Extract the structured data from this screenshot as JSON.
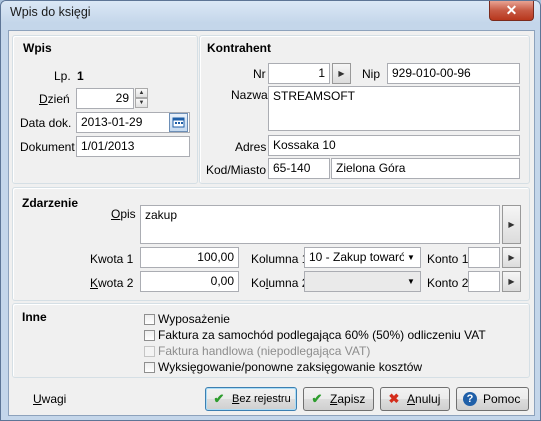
{
  "window": {
    "title": "Wpis do księgi",
    "close_glyph": "✕"
  },
  "wpis": {
    "title": "Wpis",
    "lp_label": "Lp.",
    "lp_value": "1",
    "dzien_label": "Dzień",
    "dzien_value": "29",
    "data_label": "Data dok.",
    "data_value": "2013-01-29",
    "dokument_label": "Dokument",
    "dokument_value": "1/01/2013"
  },
  "kontrahent": {
    "title": "Kontrahent",
    "nr_label": "Nr",
    "nr_value": "1",
    "nip_label": "Nip",
    "nip_value": "929-010-00-96",
    "nazwa_label": "Nazwa",
    "nazwa_value": "STREAMSOFT",
    "adres_label": "Adres",
    "adres_value": "Kossaka 10",
    "kod_label": "Kod/Miasto",
    "kod_value": "65-140",
    "miasto_value": "Zielona Góra"
  },
  "zdarzenie": {
    "title": "Zdarzenie",
    "opis_label": "Opis",
    "opis_value": "zakup",
    "kwota1_label": "Kwota 1",
    "kwota1_value": "100,00",
    "kwota2_label": "Kwota 2",
    "kwota2_value": "0,00",
    "kolumna1_label": "Kolumna 1",
    "kolumna1_value": "10 - Zakup towaró",
    "kolumna2_label": "Kolumna 2",
    "kolumna2_value": "",
    "konto1_label": "Konto 1",
    "konto1_value": "",
    "konto2_label": "Konto 2",
    "konto2_value": ""
  },
  "inne": {
    "title": "Inne",
    "options": [
      {
        "label": "Wyposażenie",
        "checked": false,
        "enabled": true
      },
      {
        "label": "Faktura za samochód podlegająca 60% (50%) odliczeniu VAT",
        "checked": false,
        "enabled": true
      },
      {
        "label": "Faktura handlowa (niepodlegająca VAT)",
        "checked": false,
        "enabled": false
      },
      {
        "label": "Wyksięgowanie/ponowne zaksięgowanie kosztów",
        "checked": false,
        "enabled": true
      }
    ]
  },
  "footer": {
    "uwagi_label": "Uwagi",
    "bez_rejestru_label": "Bez rejestru",
    "zapisz_label": "Zapisz",
    "anuluj_label": "Anuluj",
    "pomoc_label": "Pomoc"
  },
  "icons": {
    "arrow_right": "▶",
    "arrow_down": "▼",
    "spin_up": "▲",
    "spin_down": "▼",
    "check": "✔",
    "cross": "✖",
    "help": "?"
  },
  "colors": {
    "accent_green": "#2e9d2e",
    "accent_red": "#d42c1a",
    "accent_blue": "#1f5fa8"
  }
}
